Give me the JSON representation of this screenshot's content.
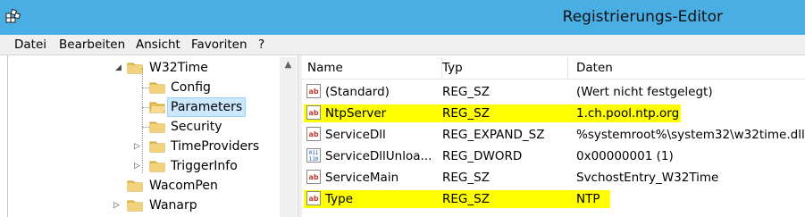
{
  "window": {
    "title": "Registrierungs-Editor",
    "app_icon": "registry-editor-icon"
  },
  "menu": [
    "Datei",
    "Bearbeiten",
    "Ansicht",
    "Favoriten",
    "?"
  ],
  "tree": [
    {
      "label": "W32Time",
      "expanded": true
    },
    {
      "label": "Config"
    },
    {
      "label": "Parameters",
      "selected": true
    },
    {
      "label": "Security"
    },
    {
      "label": "TimeProviders",
      "expandable": true
    },
    {
      "label": "TriggerInfo",
      "expandable": true
    },
    {
      "label": "WacomPen"
    },
    {
      "label": "Wanarp",
      "expandable": true
    }
  ],
  "list": {
    "columns": [
      "Name",
      "Typ",
      "Daten"
    ],
    "rows": [
      {
        "name": "(Standard)",
        "type": "REG_SZ",
        "data": "(Wert nicht festgelegt)",
        "icon": "string-value-icon",
        "highlight": false
      },
      {
        "name": "NtpServer",
        "type": "REG_SZ",
        "data": "1.ch.pool.ntp.org",
        "icon": "string-value-icon",
        "highlight": true
      },
      {
        "name": "ServiceDll",
        "type": "REG_EXPAND_SZ",
        "data": "%systemroot%\\system32\\w32time.dll",
        "icon": "string-value-icon",
        "highlight": false
      },
      {
        "name": "ServiceDllUnloa...",
        "type": "REG_DWORD",
        "data": "0x00000001 (1)",
        "icon": "binary-value-icon",
        "highlight": false
      },
      {
        "name": "ServiceMain",
        "type": "REG_SZ",
        "data": "SvchostEntry_W32Time",
        "icon": "string-value-icon",
        "highlight": false
      },
      {
        "name": "Type",
        "type": "REG_SZ",
        "data": "NTP",
        "icon": "string-value-icon",
        "highlight": true
      }
    ],
    "highlight_color": "#ffff00"
  },
  "colors": {
    "titlebar": "#49aee4",
    "selection": "#cce8ff"
  }
}
